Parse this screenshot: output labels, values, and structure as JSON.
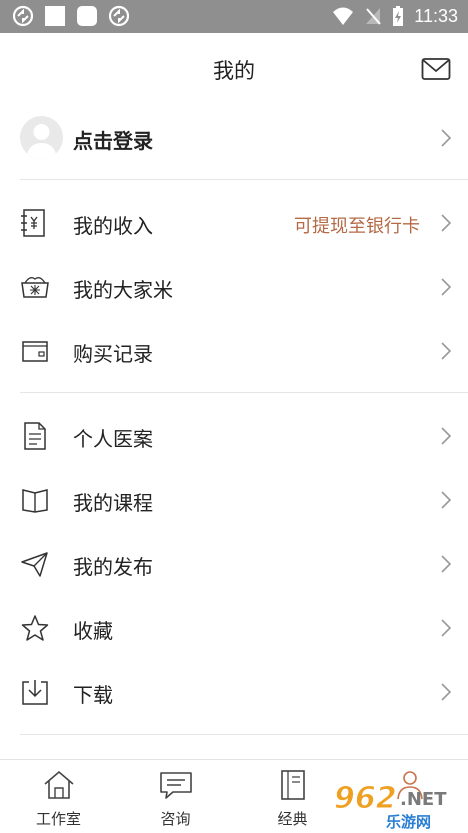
{
  "status_bar": {
    "time": "11:33"
  },
  "header": {
    "title": "我的"
  },
  "login": {
    "label": "点击登录"
  },
  "menu_group_1": [
    {
      "label": "我的收入",
      "extra": "可提现至银行卡",
      "icon": "income-icon"
    },
    {
      "label": "我的大家米",
      "extra": "",
      "icon": "rice-icon"
    },
    {
      "label": "购买记录",
      "extra": "",
      "icon": "wallet-icon"
    }
  ],
  "menu_group_2": [
    {
      "label": "个人医案",
      "icon": "document-icon"
    },
    {
      "label": "我的课程",
      "icon": "book-icon"
    },
    {
      "label": "我的发布",
      "icon": "send-icon"
    },
    {
      "label": "收藏",
      "icon": "star-icon"
    },
    {
      "label": "下载",
      "icon": "download-icon"
    }
  ],
  "tabs": [
    {
      "label": "工作室",
      "icon": "home-icon"
    },
    {
      "label": "咨询",
      "icon": "chat-icon"
    },
    {
      "label": "经典",
      "icon": "classic-book-icon"
    },
    {
      "label": "",
      "icon": "person-icon"
    }
  ],
  "watermark": {
    "logo": "962",
    "suffix": ".NET",
    "sub": "乐游网"
  },
  "colors": {
    "accent_text": "#b46a45",
    "status_bar": "#8f8f8f",
    "watermark_orange": "#f0a020",
    "watermark_blue": "#2a7fd4"
  }
}
